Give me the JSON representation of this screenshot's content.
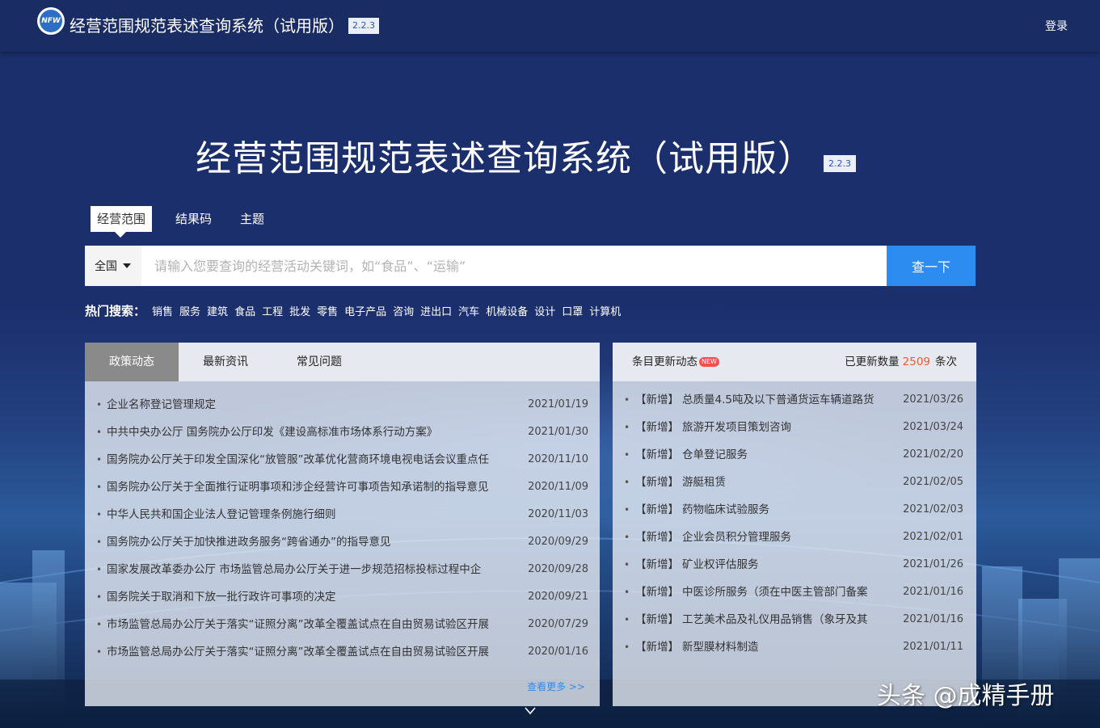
{
  "header": {
    "logo_text": "NFW",
    "app_title": "经营范围规范表述查询系统（试用版）",
    "version": "2.2.3",
    "login_label": "登录"
  },
  "hero": {
    "title": "经营范围规范表述查询系统（试用版）",
    "version": "2.2.3"
  },
  "search": {
    "tabs": [
      "经营范围",
      "结果码",
      "主题"
    ],
    "active_tab": "经营范围",
    "region": "全国",
    "placeholder": "请输入您要查询的经营活动关键词，如“食品”、“运输”",
    "button_label": "查一下"
  },
  "hot_search": {
    "label": "热门搜索：",
    "items": [
      "销售",
      "服务",
      "建筑",
      "食品",
      "工程",
      "批发",
      "零售",
      "电子产品",
      "咨询",
      "进出口",
      "汽车",
      "机械设备",
      "设计",
      "口罩",
      "计算机"
    ]
  },
  "news_panel": {
    "tabs": [
      "政策动态",
      "最新资讯",
      "常见问题"
    ],
    "active_tab": "政策动态",
    "items": [
      {
        "title": "企业名称登记管理规定",
        "date": "2021/01/19"
      },
      {
        "title": "中共中央办公厅 国务院办公厅印发《建设高标准市场体系行动方案》",
        "date": "2021/01/30"
      },
      {
        "title": "国务院办公厅关于印发全国深化“放管服”改革优化营商环境电视电话会议重点任",
        "date": "2020/11/10"
      },
      {
        "title": "国务院办公厅关于全面推行证明事项和涉企经营许可事项告知承诺制的指导意见",
        "date": "2020/11/09"
      },
      {
        "title": "中华人民共和国企业法人登记管理条例施行细则",
        "date": "2020/11/03"
      },
      {
        "title": "国务院办公厅关于加快推进政务服务“跨省通办”的指导意见",
        "date": "2020/09/29"
      },
      {
        "title": "国家发展改革委办公厅 市场监管总局办公厅关于进一步规范招标投标过程中企",
        "date": "2020/09/28"
      },
      {
        "title": "国务院关于取消和下放一批行政许可事项的决定",
        "date": "2020/09/21"
      },
      {
        "title": "市场监管总局办公厅关于落实“证照分离”改革全覆盖试点在自由贸易试验区开展",
        "date": "2020/07/29"
      },
      {
        "title": "市场监管总局办公厅关于落实“证照分离”改革全覆盖试点在自由贸易试验区开展",
        "date": "2020/01/16"
      }
    ],
    "more_label": "查看更多 >>"
  },
  "updates_panel": {
    "title": "条目更新动态",
    "new_badge": "NEW",
    "count_label": "已更新数量",
    "count": "2509",
    "count_unit": "条次",
    "items": [
      {
        "tag": "【新增】",
        "title": "总质量4.5吨及以下普通货运车辆道路货",
        "date": "2021/03/26"
      },
      {
        "tag": "【新增】",
        "title": "旅游开发项目策划咨询",
        "date": "2021/03/24"
      },
      {
        "tag": "【新增】",
        "title": "仓单登记服务",
        "date": "2021/02/20"
      },
      {
        "tag": "【新增】",
        "title": "游艇租赁",
        "date": "2021/02/05"
      },
      {
        "tag": "【新增】",
        "title": "药物临床试验服务",
        "date": "2021/02/03"
      },
      {
        "tag": "【新增】",
        "title": "企业会员积分管理服务",
        "date": "2021/02/01"
      },
      {
        "tag": "【新增】",
        "title": "矿业权评估服务",
        "date": "2021/01/26"
      },
      {
        "tag": "【新增】",
        "title": "中医诊所服务（须在中医主管部门备案",
        "date": "2021/01/16"
      },
      {
        "tag": "【新增】",
        "title": "工艺美术品及礼仪用品销售（象牙及其",
        "date": "2021/01/16"
      },
      {
        "tag": "【新增】",
        "title": "新型膜材料制造",
        "date": "2021/01/11"
      }
    ]
  },
  "watermark": "头条 @成精手册",
  "colors": {
    "header_bg": "#1a2c64",
    "page_bg": "#1c2f6d",
    "accent_blue": "#2d8cf0",
    "count_orange": "#f5572f"
  }
}
